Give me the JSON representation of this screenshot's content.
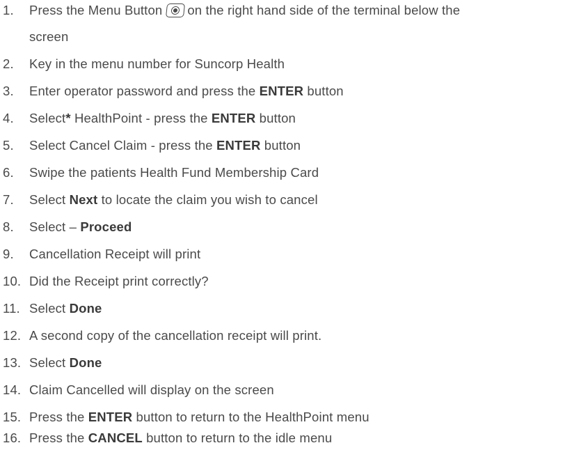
{
  "steps": [
    {
      "num": "1.",
      "pre": "Press the Menu Button",
      "icon": "menu-button-icon",
      "post": "on the right hand side of the terminal below the",
      "cont": "screen"
    },
    {
      "num": "2.",
      "pre": "Key in the menu number for Suncorp Health"
    },
    {
      "num": "3.",
      "pre": "Enter operator password and press the ",
      "bold": "ENTER",
      "post": " button"
    },
    {
      "num": "4.",
      "pre": "Select",
      "bold": "*",
      "post": " HealthPoint - press the ",
      "bold2": "ENTER",
      "post2": " button"
    },
    {
      "num": "5.",
      "pre": "Select Cancel Claim - press the ",
      "bold": "ENTER",
      "post": " button"
    },
    {
      "num": "6.",
      "pre": "Swipe the patients Health Fund Membership Card"
    },
    {
      "num": "7.",
      "pre": "Select ",
      "bold": "Next",
      "post": " to locate the claim you wish to cancel"
    },
    {
      "num": "8.",
      "pre": "Select – ",
      "bold": "Proceed"
    },
    {
      "num": "9.",
      "pre": "Cancellation Receipt will print"
    },
    {
      "num": "10.",
      "pre": "Did the Receipt print correctly?"
    },
    {
      "num": "11.",
      "pre": "Select ",
      "bold": "Done"
    },
    {
      "num": "12.",
      "pre": "A second copy of the cancellation receipt will print."
    },
    {
      "num": "13.",
      "pre": "Select ",
      "bold": "Done"
    },
    {
      "num": "14.",
      "pre": "Claim Cancelled will display on the screen"
    },
    {
      "num": "15.",
      "pre": "Press the ",
      "bold": "ENTER",
      "post": " button to return to the HealthPoint menu"
    },
    {
      "num": "16.",
      "pre": "Press the ",
      "bold": "CANCEL",
      "post": " button to return to the idle menu"
    }
  ]
}
